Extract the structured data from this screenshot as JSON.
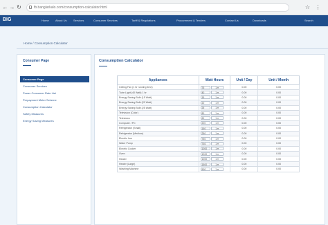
{
  "browser": {
    "url": "fb.banglarkalo.com/consumption-calculator.html",
    "back_icon": "arrow-left-icon",
    "forward_icon": "arrow-right-icon",
    "reload_icon": "reload-icon"
  },
  "nav": {
    "brand": "BIG",
    "links": [
      "Home",
      "About Us",
      "Services",
      "Consumer Services",
      "Tariff & Regulations",
      "Procurement & Tenders",
      "Contact Us",
      "Downloads",
      "Search"
    ]
  },
  "breadcrumb": "Home / Consumption Calculator",
  "sidebar": {
    "title": "Consumer Page",
    "items": [
      "Consumer Page",
      "Consumer Services",
      "Power Consumer Rate List",
      "Prepayment Meter Scheme",
      "Consumption Calculator",
      "Safety Measures",
      "Energy Saving Measures"
    ]
  },
  "main": {
    "title": "Consumption Calculator"
  },
  "table": {
    "headers": [
      "Appliances",
      "Watt Hours",
      "Unit / Day",
      "Unit / Month"
    ],
    "rows": [
      {
        "app": "Ceiling Fan (1 hr running time)",
        "watt": "75",
        "hours": "1",
        "day": "0.00",
        "month": "0.00"
      },
      {
        "app": "Tube Light (40 Watt) 1 hr",
        "watt": "40",
        "hours": "1",
        "day": "0.00",
        "month": "0.00"
      },
      {
        "app": "Energy Saving Bulb (15 Watt)",
        "watt": "15",
        "hours": "1",
        "day": "0.00",
        "month": "0.00"
      },
      {
        "app": "Energy Saving Bulb (20 Watt)",
        "watt": "20",
        "hours": "1",
        "day": "0.00",
        "month": "0.00"
      },
      {
        "app": "Energy Saving Bulb (25 Watt)",
        "watt": "25",
        "hours": "1",
        "day": "0.00",
        "month": "0.00"
      },
      {
        "app": "Television (Color)",
        "watt": "80",
        "hours": "1",
        "day": "0.00",
        "month": "0.00"
      },
      {
        "app": "Television",
        "watt": "60",
        "hours": "1",
        "day": "0.00",
        "month": "0.00"
      },
      {
        "app": "Computer / PC",
        "watt": "200",
        "hours": "1",
        "day": "0.00",
        "month": "0.00"
      },
      {
        "app": "Refrigerator (Small)",
        "watt": "150",
        "hours": "1",
        "day": "0.00",
        "month": "0.00"
      },
      {
        "app": "Refrigerator (Medium)",
        "watt": "250",
        "hours": "1",
        "day": "0.00",
        "month": "0.00"
      },
      {
        "app": "Electric Iron",
        "watt": "750",
        "hours": "1",
        "day": "0.00",
        "month": "0.00"
      },
      {
        "app": "Water Pump",
        "watt": "746",
        "hours": "1",
        "day": "0.00",
        "month": "0.00"
      },
      {
        "app": "Electric Cooker",
        "watt": "1000",
        "hours": "1",
        "day": "0.00",
        "month": "0.00"
      },
      {
        "app": "Oven",
        "watt": "1200",
        "hours": "1",
        "day": "0.00",
        "month": "0.00"
      },
      {
        "app": "Heater",
        "watt": "1000",
        "hours": "1",
        "day": "0.00",
        "month": "0.00"
      },
      {
        "app": "Heater (Large)",
        "watt": "1500",
        "hours": "1",
        "day": "0.00",
        "month": "0.00"
      },
      {
        "app": "Washing Machine",
        "watt": "500",
        "hours": "1",
        "day": "0.00",
        "month": "0.00"
      }
    ]
  }
}
